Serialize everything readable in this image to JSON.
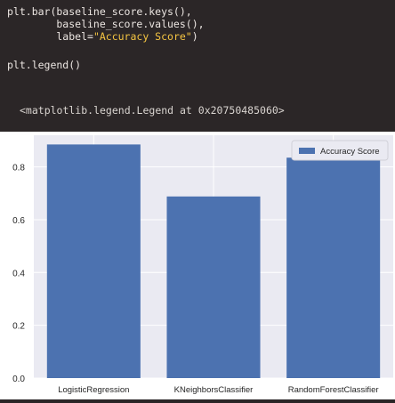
{
  "code": {
    "line1": "plt.bar(baseline_score.keys(),",
    "line2": "        baseline_score.values(),",
    "line3_prefix": "        label=",
    "line3_string": "\"Accuracy Score\"",
    "line3_suffix": ")",
    "line4": "plt.legend()"
  },
  "output": {
    "text": "<matplotlib.legend.Legend at 0x20750485060>"
  },
  "colors": {
    "code_bg": "#2b2627",
    "string": "#f5c542",
    "plot_bg": "#eaeaf2",
    "bar": "#4c72b0"
  },
  "chart_data": {
    "type": "bar",
    "categories": [
      "LogisticRegression",
      "KNeighborsClassifier",
      "RandomForestClassifier"
    ],
    "series": [
      {
        "name": "Accuracy Score",
        "values": [
          0.885,
          0.688,
          0.835
        ]
      }
    ],
    "ylim": [
      0.0,
      0.92
    ],
    "yticks": [
      0.0,
      0.2,
      0.4,
      0.6,
      0.8
    ],
    "ytick_labels": [
      "0.0",
      "0.2",
      "0.4",
      "0.6",
      "0.8"
    ],
    "grid": true,
    "legend_position": "top-right"
  }
}
